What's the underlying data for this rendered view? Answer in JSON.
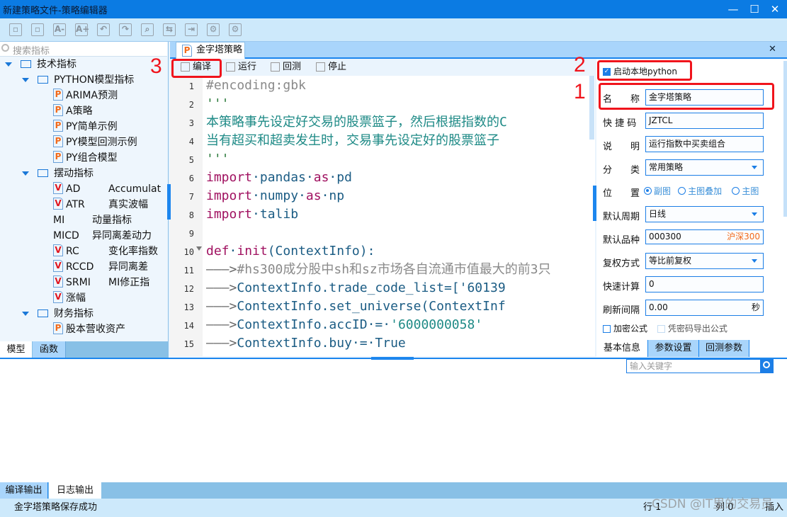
{
  "window": {
    "title": "新建策略文件-策略编辑器",
    "min": "—",
    "max": "☐",
    "close": "✕"
  },
  "toolbar": [
    "save",
    "save-all",
    "font-smaller",
    "font-larger",
    "undo",
    "redo",
    "find",
    "replace",
    "export",
    "settings",
    "settings2"
  ],
  "left": {
    "search_placeholder": "搜索指标",
    "tree": [
      {
        "level": 0,
        "type": "folder",
        "label": "技术指标"
      },
      {
        "level": 1,
        "type": "folder",
        "label": "PYTHON模型指标"
      },
      {
        "level": 2,
        "type": "p",
        "label": "ARIMA预测"
      },
      {
        "level": 2,
        "type": "p",
        "label": "A策略"
      },
      {
        "level": 2,
        "type": "p",
        "label": "PY简单示例"
      },
      {
        "level": 2,
        "type": "p",
        "label": "PY模型回测示例"
      },
      {
        "level": 2,
        "type": "p",
        "label": "PY组合模型"
      },
      {
        "level": 1,
        "type": "folder",
        "label": "摆动指标"
      },
      {
        "level": 2,
        "type": "v",
        "label": "AD",
        "desc": "Accumulat"
      },
      {
        "level": 2,
        "type": "v",
        "label": "ATR",
        "desc": "真实波幅"
      },
      {
        "level": 2,
        "type": "none",
        "label": "MI",
        "desc": "动量指标"
      },
      {
        "level": 2,
        "type": "none",
        "label": "MICD",
        "desc": "异同离差动力"
      },
      {
        "level": 2,
        "type": "v",
        "label": "RC",
        "desc": "变化率指数"
      },
      {
        "level": 2,
        "type": "v",
        "label": "RCCD",
        "desc": "异同离差"
      },
      {
        "level": 2,
        "type": "v",
        "label": "SRMI",
        "desc": "MI修正指"
      },
      {
        "level": 2,
        "type": "lv",
        "label": "涨幅"
      },
      {
        "level": 1,
        "type": "folder",
        "label": "财务指标"
      },
      {
        "level": 2,
        "type": "p",
        "label": "股本营收资产"
      }
    ],
    "tabs": [
      "模型",
      "函数"
    ]
  },
  "editor": {
    "tab": "金字塔策略",
    "close": "✕",
    "tools": [
      "编译",
      "运行",
      "回测",
      "停止"
    ],
    "lines": [
      [
        [
          "#encoding:gbk",
          "c"
        ]
      ],
      [
        [
          "'''",
          "q"
        ]
      ],
      [
        [
          "本策略事先设定好交易的股票篮子，然后根据指数的C",
          "z"
        ]
      ],
      [
        [
          "当有超买和超卖发生时，交易事先设定好的股票篮子",
          "z"
        ]
      ],
      [
        [
          "'''",
          "q"
        ]
      ],
      [
        [
          "import",
          "k"
        ],
        [
          "·pandas·",
          "s"
        ],
        [
          "as",
          "k"
        ],
        [
          "·pd",
          "s"
        ]
      ],
      [
        [
          "import",
          "k"
        ],
        [
          "·numpy·",
          "s"
        ],
        [
          "as",
          "k"
        ],
        [
          "·np",
          "s"
        ]
      ],
      [
        [
          "import",
          "k"
        ],
        [
          "·talib",
          "s"
        ]
      ],
      [],
      [
        [
          "def",
          "k"
        ],
        [
          "·",
          "s"
        ],
        [
          "init",
          "k"
        ],
        [
          "(ContextInfo):",
          "s"
        ]
      ],
      [
        [
          "———>",
          "tab"
        ],
        [
          "#hs300成分股中sh和sz市场各自流通市值最大的前3只",
          "c"
        ]
      ],
      [
        [
          "———>",
          "tab"
        ],
        [
          "ContextInfo.trade_code_list=['60139",
          "s"
        ]
      ],
      [
        [
          "———>",
          "tab"
        ],
        [
          "ContextInfo.set_universe(ContextInf",
          "s"
        ]
      ],
      [
        [
          "———>",
          "tab"
        ],
        [
          "ContextInfo.accID·=·",
          "s"
        ],
        [
          "'6000000058'",
          "z"
        ]
      ],
      [
        [
          "———>",
          "tab"
        ],
        [
          "ContextInfo.buy·=·True",
          "s"
        ]
      ]
    ]
  },
  "props": {
    "local_python": {
      "label": "启动本地python",
      "checked": true
    },
    "name": {
      "label": "名　　称",
      "value": "金字塔策略"
    },
    "code": {
      "label": "快 捷 码",
      "value": "JZTCL"
    },
    "desc": {
      "label": "说　　明",
      "value": "运行指数中买卖组合"
    },
    "category": {
      "label": "分　　类",
      "value": "常用策略"
    },
    "position": {
      "label": "位　　置",
      "options": [
        "副图",
        "主图叠加",
        "主图"
      ],
      "selected": "副图"
    },
    "period": {
      "label": "默认周期",
      "value": "日线"
    },
    "symbol": {
      "label": "默认品种",
      "value": "000300",
      "hint": "沪深300"
    },
    "adjust": {
      "label": "复权方式",
      "value": "等比前复权"
    },
    "fastcalc": {
      "label": "快速计算",
      "value": "0"
    },
    "refresh": {
      "label": "刷新间隔",
      "value": "0.00",
      "unit": "秒"
    },
    "encrypt": "加密公式",
    "pwd_export": "凭密码导出公式",
    "tabs": [
      "基本信息",
      "参数设置",
      "回测参数"
    ]
  },
  "bottom": {
    "keyword_placeholder": "输入关键字",
    "tabs": [
      "编译输出",
      "日志输出"
    ]
  },
  "status": {
    "message": "金字塔策略保存成功",
    "row": "行 1",
    "col": "列 0",
    "mode": "插入"
  },
  "annotations": [
    "1",
    "2",
    "3"
  ],
  "watermark": "CSDN @IT里的交易员",
  "colors": {
    "accent": "#1c86ee",
    "annotation": "#f0141c",
    "titlebar": "#0b7be3"
  }
}
